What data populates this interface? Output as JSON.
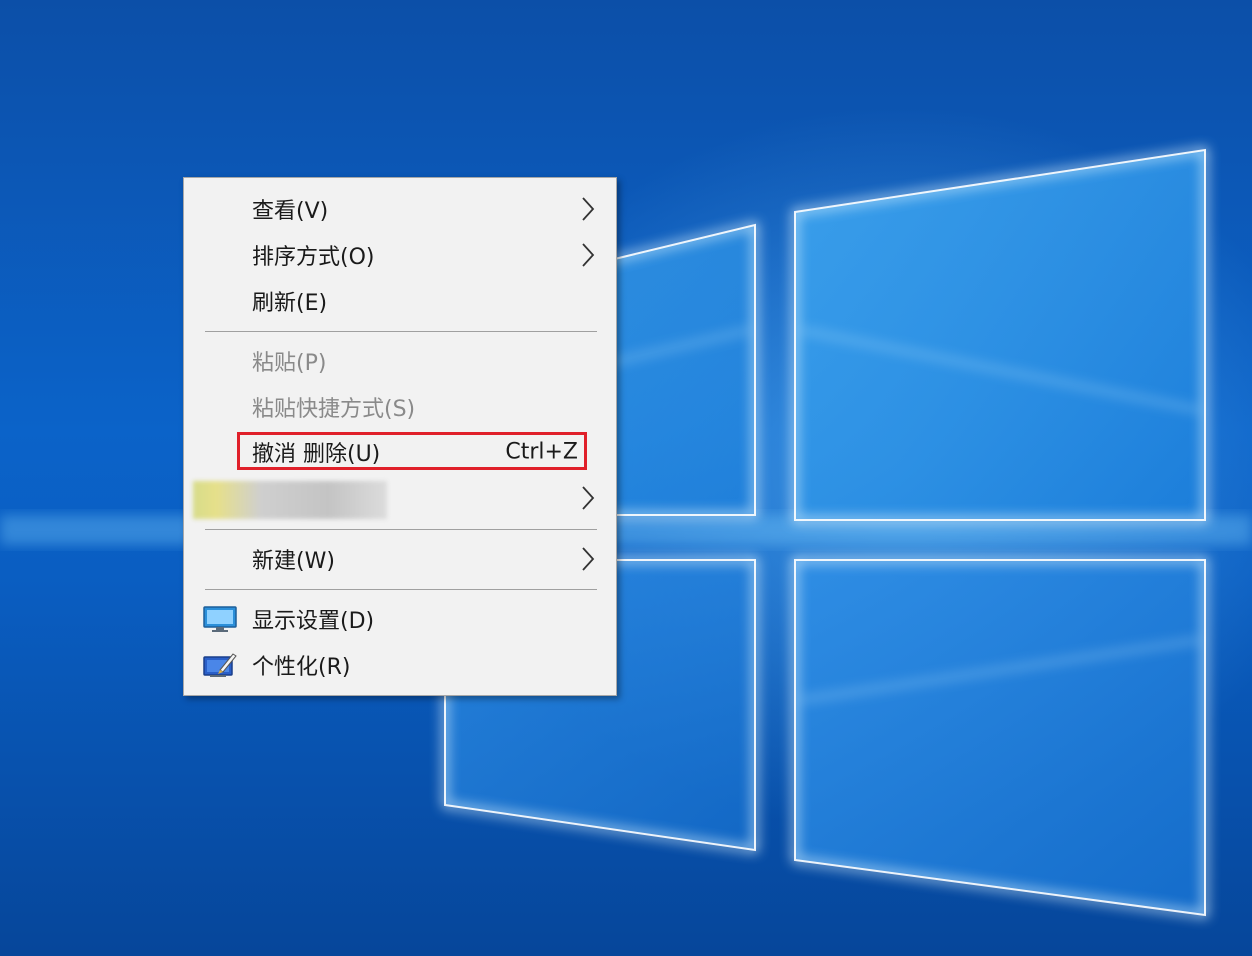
{
  "context_menu": {
    "items": [
      {
        "label": "查看(V)",
        "has_submenu": true,
        "disabled": false
      },
      {
        "label": "排序方式(O)",
        "has_submenu": true,
        "disabled": false
      },
      {
        "label": "刷新(E)",
        "has_submenu": false,
        "disabled": false
      },
      {
        "label": "粘贴(P)",
        "has_submenu": false,
        "disabled": true
      },
      {
        "label": "粘贴快捷方式(S)",
        "has_submenu": false,
        "disabled": true
      },
      {
        "label": "撤消 删除(U)",
        "shortcut": "Ctrl+Z",
        "has_submenu": false,
        "disabled": false,
        "highlighted": true
      },
      {
        "label": "",
        "has_submenu": true,
        "disabled": false,
        "blurred": true
      },
      {
        "label": "新建(W)",
        "has_submenu": true,
        "disabled": false
      },
      {
        "label": "显示设置(D)",
        "icon": "display-settings-icon",
        "has_submenu": false,
        "disabled": false
      },
      {
        "label": "个性化(R)",
        "icon": "personalize-icon",
        "has_submenu": false,
        "disabled": false
      }
    ]
  },
  "colors": {
    "desktop_background": "#0a57b8",
    "menu_background": "#f2f2f2",
    "highlight_border": "#e0202a",
    "disabled_text": "#8a8a8a"
  }
}
